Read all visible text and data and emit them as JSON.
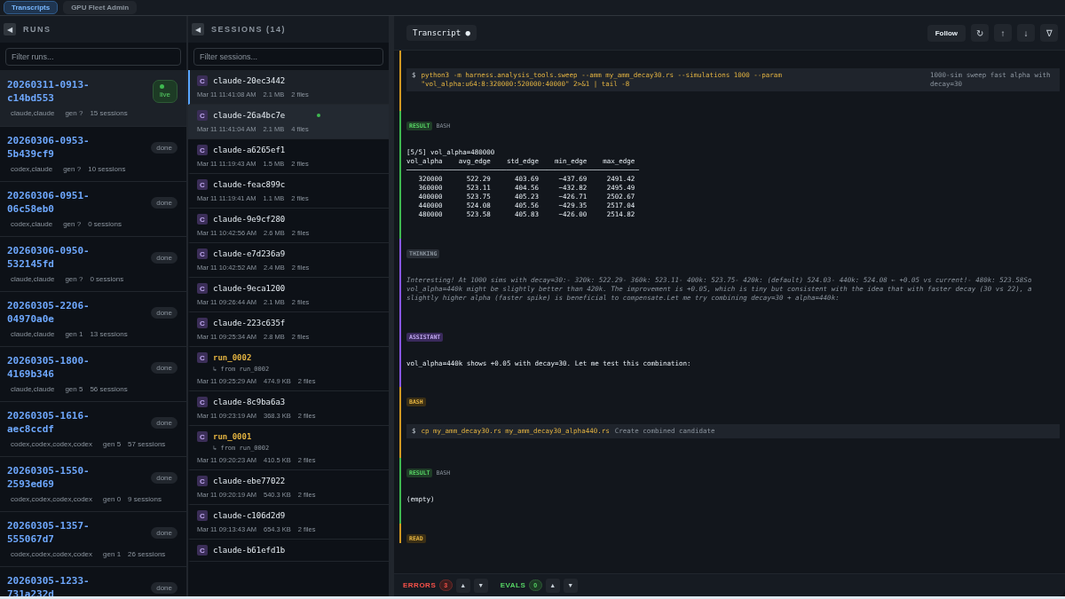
{
  "top_tabs": [
    {
      "label": "Transcripts",
      "selected": true
    },
    {
      "label": "GPU Fleet Admin",
      "selected": false
    }
  ],
  "runs": {
    "title": "RUNS",
    "collapse": "◀",
    "filter_placeholder": "Filter runs...",
    "items": [
      {
        "id": "20260311-0913-c14bd553",
        "agents": "claude,claude",
        "gen": "gen ?",
        "sessions": "15 sessions",
        "status": "live",
        "selected": true
      },
      {
        "id": "20260306-0953-5b439cf9",
        "agents": "codex,claude",
        "gen": "gen ?",
        "sessions": "10 sessions",
        "status": "done",
        "selected": false
      },
      {
        "id": "20260306-0951-06c58eb0",
        "agents": "codex,claude",
        "gen": "gen ?",
        "sessions": "0 sessions",
        "status": "done",
        "selected": false
      },
      {
        "id": "20260306-0950-532145fd",
        "agents": "claude,claude",
        "gen": "gen ?",
        "sessions": "0 sessions",
        "status": "done",
        "selected": false
      },
      {
        "id": "20260305-2206-04970a0e",
        "agents": "claude,claude",
        "gen": "gen 1",
        "sessions": "13 sessions",
        "status": "done",
        "selected": false
      },
      {
        "id": "20260305-1800-4169b346",
        "agents": "claude,claude",
        "gen": "gen 5",
        "sessions": "56 sessions",
        "status": "done",
        "selected": false
      },
      {
        "id": "20260305-1616-aec8ccdf",
        "agents": "codex,codex,codex,codex",
        "gen": "gen 5",
        "sessions": "57 sessions",
        "status": "done",
        "selected": false
      },
      {
        "id": "20260305-1550-2593ed69",
        "agents": "codex,codex,codex,codex",
        "gen": "gen 0",
        "sessions": "9 sessions",
        "status": "done",
        "selected": false
      },
      {
        "id": "20260305-1357-555067d7",
        "agents": "codex,codex,codex,codex",
        "gen": "gen 1",
        "sessions": "26 sessions",
        "status": "done",
        "selected": false
      },
      {
        "id": "20260305-1233-731a232d",
        "status": "done",
        "selected": false
      }
    ]
  },
  "sessions": {
    "title": "SESSIONS (14)",
    "collapse": "◀",
    "filter_placeholder": "Filter sessions...",
    "items": [
      {
        "kind": "claude",
        "badge": "C",
        "name": "claude-20ec3442",
        "time": "Mar 11 11:41:08 AM",
        "size": "2.1 MB",
        "files": "2 files",
        "selected": true,
        "active": false
      },
      {
        "kind": "claude",
        "badge": "C",
        "name": "claude-26a4bc7e",
        "time": "Mar 11 11:41:04 AM",
        "size": "2.1 MB",
        "files": "4 files",
        "selected": false,
        "active": true
      },
      {
        "kind": "claude",
        "badge": "C",
        "name": "claude-a6265ef1",
        "time": "Mar 11 11:19:43 AM",
        "size": "1.5 MB",
        "files": "2 files",
        "selected": false,
        "active": false
      },
      {
        "kind": "claude",
        "badge": "C",
        "name": "claude-feac899c",
        "time": "Mar 11 11:19:41 AM",
        "size": "1.1 MB",
        "files": "2 files",
        "selected": false,
        "active": false
      },
      {
        "kind": "claude",
        "badge": "C",
        "name": "claude-9e9cf280",
        "time": "Mar 11 10:42:56 AM",
        "size": "2.6 MB",
        "files": "2 files",
        "selected": false,
        "active": false
      },
      {
        "kind": "claude",
        "badge": "C",
        "name": "claude-e7d236a9",
        "time": "Mar 11 10:42:52 AM",
        "size": "2.4 MB",
        "files": "2 files",
        "selected": false,
        "active": false
      },
      {
        "kind": "claude",
        "badge": "C",
        "name": "claude-9eca1200",
        "time": "Mar 11 09:26:44 AM",
        "size": "2.1 MB",
        "files": "2 files",
        "selected": false,
        "active": false
      },
      {
        "kind": "claude",
        "badge": "C",
        "name": "claude-223c635f",
        "time": "Mar 11 09:25:34 AM",
        "size": "2.8 MB",
        "files": "2 files",
        "selected": false,
        "active": false
      },
      {
        "kind": "run",
        "badge": "C",
        "name": "run_0002",
        "from": "↳ from run_0002",
        "time": "Mar 11 09:25:29 AM",
        "size": "474.9 KB",
        "files": "2 files",
        "selected": false,
        "active": false
      },
      {
        "kind": "claude",
        "badge": "C",
        "name": "claude-8c9ba6a3",
        "time": "Mar 11 09:23:19 AM",
        "size": "368.3 KB",
        "files": "2 files",
        "selected": false,
        "active": false
      },
      {
        "kind": "run",
        "badge": "C",
        "name": "run_0001",
        "from": "↳ from run_0002",
        "time": "Mar 11 09:20:23 AM",
        "size": "410.5 KB",
        "files": "2 files",
        "selected": false,
        "active": false
      },
      {
        "kind": "claude",
        "badge": "C",
        "name": "claude-ebe77022",
        "time": "Mar 11 09:20:19 AM",
        "size": "540.3 KB",
        "files": "2 files",
        "selected": false,
        "active": false
      },
      {
        "kind": "claude",
        "badge": "C",
        "name": "claude-c106d2d9",
        "time": "Mar 11 09:13:43 AM",
        "size": "654.3 KB",
        "files": "2 files",
        "selected": false,
        "active": false
      },
      {
        "kind": "claude",
        "badge": "C",
        "name": "claude-b61efd1b",
        "selected": false,
        "active": false
      }
    ]
  },
  "transcript": {
    "tab": "Transcript ●",
    "follow": "Follow",
    "tools": [
      "↻",
      "↑",
      "↓",
      "∇"
    ],
    "entries": [
      {
        "kind": "bash",
        "command": "python3 -m harness.analysis_tools.sweep --amm my_amm_decay30.rs --simulations 1000 --param \"vol_alpha:u64:8:320000:520000:40000\" 2>&1 | tail -8",
        "prompt": "$",
        "note": "1000-sim sweep fast alpha with decay=30"
      },
      {
        "kind": "result",
        "label": "RESULT",
        "sublabel": "BASH",
        "output": "[5/5] vol_alpha=480000\nvol_alpha    avg_edge    std_edge    min_edge    max_edge\n──────────────────────────────────────────────────────────\n   320000      522.29      403.69     −437.69     2491.42\n   360000      523.11      404.56     −432.82     2495.49\n   400000      523.75      405.23     −426.71     2502.67\n   440000      524.08      405.56     −429.35     2517.04\n   480000      523.58      405.83     −426.00     2514.82"
      },
      {
        "kind": "thinking",
        "label": "THINKING",
        "text": "Interesting! At 1000 sims with decay=30:- 320k: 522.29- 360k: 523.11- 400k: 523.75- 420k: (default) 524.03- 440k: 524.08 ← +0.05 vs current!- 480k: 523.58So vol_alpha=440k might be slightly better than 420k. The improvement is +0.05, which is tiny but consistent with the idea that with faster decay (30 vs 22), a slightly higher alpha (faster spike) is beneficial to compensate.Let me try combining decay=30 + alpha=440k:"
      },
      {
        "kind": "assistant",
        "label": "ASSISTANT",
        "text": "vol_alpha=440k shows +0.05 with decay=30. Let me test this combination:"
      },
      {
        "kind": "bash",
        "label": "BASH",
        "prompt": "$",
        "command": "cp my_amm_decay30.rs my_amm_decay30_alpha440.rs",
        "note": "Create combined candidate"
      },
      {
        "kind": "result",
        "label": "RESULT",
        "sublabel": "BASH",
        "output": "(empty)"
      },
      {
        "kind": "read",
        "label": "READ"
      }
    ]
  },
  "footer": {
    "errors_label": "ERRORS",
    "errors_count": "3",
    "evals_label": "EVALS",
    "evals_count": "0",
    "up": "▲",
    "down": "▼"
  }
}
